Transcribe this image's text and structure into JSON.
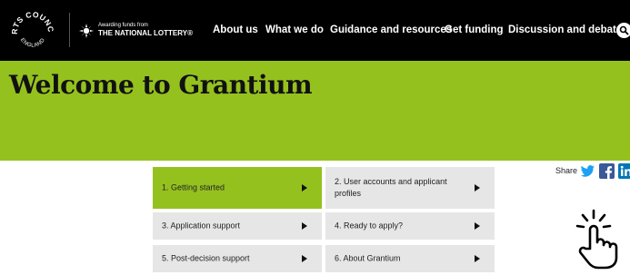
{
  "logo": {
    "text_top": "ARTS COUNCIL",
    "text_bottom": "ENGLAND"
  },
  "lottery": {
    "small": "Awarding funds from",
    "big": "THE NATIONAL LOTTERY®"
  },
  "nav": {
    "items": [
      {
        "label": "About us"
      },
      {
        "label": "What we do"
      },
      {
        "label": "Guidance and resources"
      },
      {
        "label": "Get funding"
      },
      {
        "label": "Discussion and debate"
      }
    ],
    "search_icon": "search-icon"
  },
  "hero": {
    "title": "Welcome to Grantium"
  },
  "menu": {
    "tiles": [
      {
        "label": "1.  Getting started",
        "active": true
      },
      {
        "label": "2.  User accounts and applicant profiles",
        "active": false
      },
      {
        "label": "3.  Application support",
        "active": false
      },
      {
        "label": "4.  Ready to apply?",
        "active": false
      },
      {
        "label": "5.  Post-decision support",
        "active": false
      },
      {
        "label": "6.  About Grantium",
        "active": false
      }
    ]
  },
  "share": {
    "label": "Share",
    "icons": [
      "twitter-icon",
      "facebook-icon",
      "linkedin-icon"
    ]
  },
  "colors": {
    "header_bg": "#000000",
    "accent_green": "#95c11f",
    "tile_grey": "#e6e6e6",
    "twitter_blue": "#1da1f2",
    "facebook_blue": "#3b5998",
    "linkedin_blue": "#0077b5"
  }
}
